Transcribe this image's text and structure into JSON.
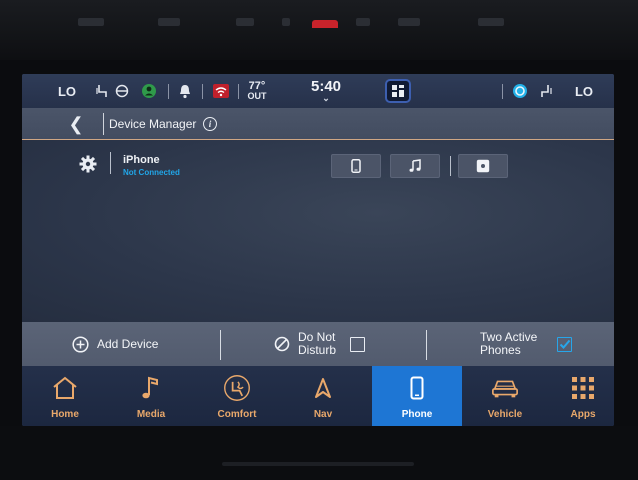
{
  "status_bar": {
    "left_climate": "LO",
    "right_climate": "LO",
    "temperature": "77°",
    "temperature_label": "OUT",
    "time": "5:40",
    "icons": [
      "seat-heat-icon",
      "steering-heat-icon",
      "driver-profile-icon",
      "notification-bell-icon",
      "wifi-icon",
      "app-drawer-icon",
      "alexa-icon",
      "passenger-seat-icon"
    ],
    "colors": {
      "accent": "#1e76d4",
      "status_blue": "#21a6e8",
      "nav_label": "#e9a86b"
    }
  },
  "header": {
    "title": "Device Manager"
  },
  "device": {
    "name": "iPhone",
    "status": "Not Connected",
    "profile_buttons": [
      "phone-icon",
      "music-note-icon",
      "media-player-icon"
    ]
  },
  "actions": {
    "add_device": "Add Device",
    "do_not_disturb_line1": "Do Not",
    "do_not_disturb_line2": "Disturb",
    "do_not_disturb_checked": false,
    "two_active_line1": "Two Active",
    "two_active_line2": "Phones",
    "two_active_checked": true
  },
  "nav": {
    "items": [
      {
        "label": "Home",
        "icon": "home-icon",
        "active": false
      },
      {
        "label": "Media",
        "icon": "music-note-icon",
        "active": false
      },
      {
        "label": "Comfort",
        "icon": "comfort-icon",
        "active": false
      },
      {
        "label": "Nav",
        "icon": "navigation-arrow-icon",
        "active": false
      },
      {
        "label": "Phone",
        "icon": "phone-icon",
        "active": true
      },
      {
        "label": "Vehicle",
        "icon": "vehicle-icon",
        "active": false
      },
      {
        "label": "Apps",
        "icon": "apps-grid-icon",
        "active": false
      }
    ]
  }
}
